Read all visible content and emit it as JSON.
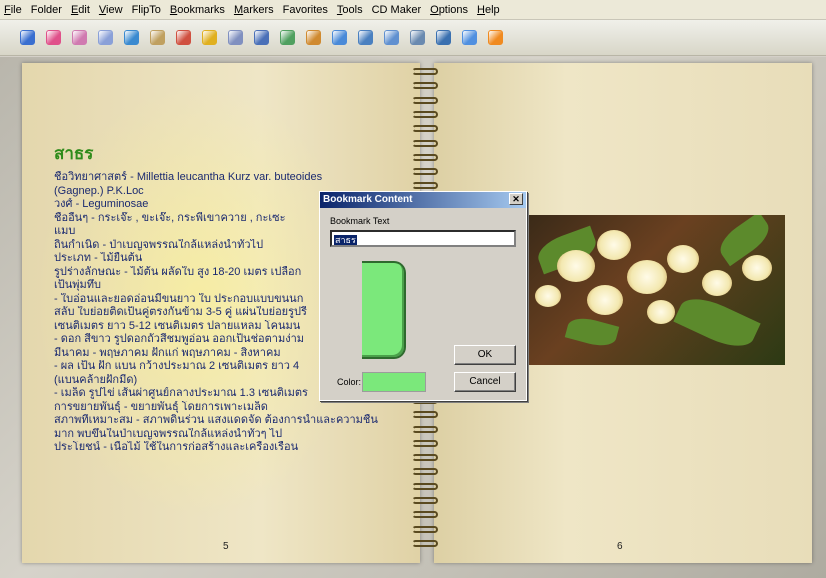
{
  "menu": {
    "items": [
      {
        "label": "File",
        "accel": "F",
        "rest": "ile"
      },
      {
        "label": "Folder",
        "accel": "",
        "rest": "Folder"
      },
      {
        "label": "Edit",
        "accel": "E",
        "rest": "dit"
      },
      {
        "label": "View",
        "accel": "V",
        "rest": "iew"
      },
      {
        "label": "FlipTo",
        "accel": "",
        "rest": "FlipTo"
      },
      {
        "label": "Bookmarks",
        "accel": "B",
        "rest": "ookmarks"
      },
      {
        "label": "Markers",
        "accel": "M",
        "rest": "arkers"
      },
      {
        "label": "Favorites",
        "accel": "",
        "rest": "Favorites"
      },
      {
        "label": "Tools",
        "accel": "T",
        "rest": "ools"
      },
      {
        "label": "CD Maker",
        "accel": "",
        "rest": "CD Maker"
      },
      {
        "label": "Options",
        "accel": "O",
        "rest": "ptions"
      },
      {
        "label": "Help",
        "accel": "H",
        "rest": "elp"
      }
    ]
  },
  "toolbar": {
    "icons": [
      {
        "name": "eye-icon",
        "color": "#3a6fd0"
      },
      {
        "name": "page-pink-icon",
        "color": "#e0508a"
      },
      {
        "name": "two-pages-icon",
        "color": "#d07ab0"
      },
      {
        "name": "single-page-icon",
        "color": "#8aa0d8"
      },
      {
        "name": "arrow-forward-icon",
        "color": "#3a8ad0"
      },
      {
        "name": "table-icon",
        "color": "#c0a060"
      },
      {
        "name": "disk-icon",
        "color": "#d05040"
      },
      {
        "name": "plus-icon",
        "color": "#e0b020"
      },
      {
        "name": "pencil-icon",
        "color": "#8090c0"
      },
      {
        "name": "columns-icon",
        "color": "#4a70b8"
      },
      {
        "name": "link-icon",
        "color": "#50a060"
      },
      {
        "name": "book-icon",
        "color": "#d08a30"
      },
      {
        "name": "globe-icon",
        "color": "#4a8ad8"
      },
      {
        "name": "layout-icon",
        "color": "#4a80c0"
      },
      {
        "name": "window-icon",
        "color": "#6090d0"
      },
      {
        "name": "monitor-icon",
        "color": "#6a8ab0"
      },
      {
        "name": "search-icon",
        "color": "#3a70b0"
      },
      {
        "name": "play-icon",
        "color": "#5090e0"
      },
      {
        "name": "record-icon",
        "color": "#f08a20"
      }
    ]
  },
  "book": {
    "title": "สาธร",
    "lines": [
      "ชื่อวิทยาศาสตร์ - Millettia leucantha Kurz var. buteoides",
      "(Gagnep.) P.K.Loc",
      "วงศ์ - Leguminosae",
      "ชื่ออื่นๆ - กระเจ๊ะ , ขะเจ๊ะ, กระพี้เขาควาย , กะเซะ",
      "แมบ",
      "ถิ่นกำเนิด - ป่าเบญจพรรณใกล้แหล่งน้ำทั่วไป",
      "ประเภท - ไม้ยืนต้น",
      "รูปร่างลักษณะ - ไม้ต้น ผลัดใบ สูง 18-20 เมตร เปลือก",
      "เป็นพุ่มทึบ",
      "- ใบอ่อนและยอดอ่อนมีขนยาว ใบ ประกอบแบบขนนก",
      "สลับ ใบย่อยติดเป็นคู่ตรงกันข้าม 3-5 คู่ แผ่นใบย่อยรูปรี",
      "เซนติเมตร ยาว 5-12 เซนติเมตร ปลายแหลม โคนมน",
      "- ดอก สีขาว รูปดอกถั่วสีชมพูอ่อน ออกเป็นช่อตามง่าม",
      "มีนาคม - พฤษภาคม ฝักแก่ พฤษภาคม - สิงหาคม",
      "- ผล เป็น ฝัก แบน กว้างประมาณ 2 เซนติเมตร ยาว 4",
      "(แบนคล้ายฝักมีด)",
      "- เมล็ด รูปไข่ เส้นผ่าศูนย์กลางประมาณ 1.3 เซนติเมตร",
      "การขยายพันธุ์ - ขยายพันธุ์ โดยการเพาะเมล็ด",
      "สภาพที่เหมาะสม - สภาพดินร่วน แสงแดดจัด ต้องการน้ำและความชื้น",
      "มาก พบขึ้นในป่าเบญจพรรณใกล้แหล่งน้ำทั่วๆ ไป",
      "ประโยชน์ - เนื้อไม้ ใช้ในการก่อสร้างและเครื่องเรือน"
    ],
    "left_page_number": "5",
    "right_page_number": "6"
  },
  "dialog": {
    "title": "Bookmark Content",
    "close_glyph": "✕",
    "text_label": "Bookmark Text",
    "text_value": "สาธร",
    "ok_label": "OK",
    "cancel_label": "Cancel",
    "color_label": "Color:",
    "color_value": "#7be87b"
  }
}
